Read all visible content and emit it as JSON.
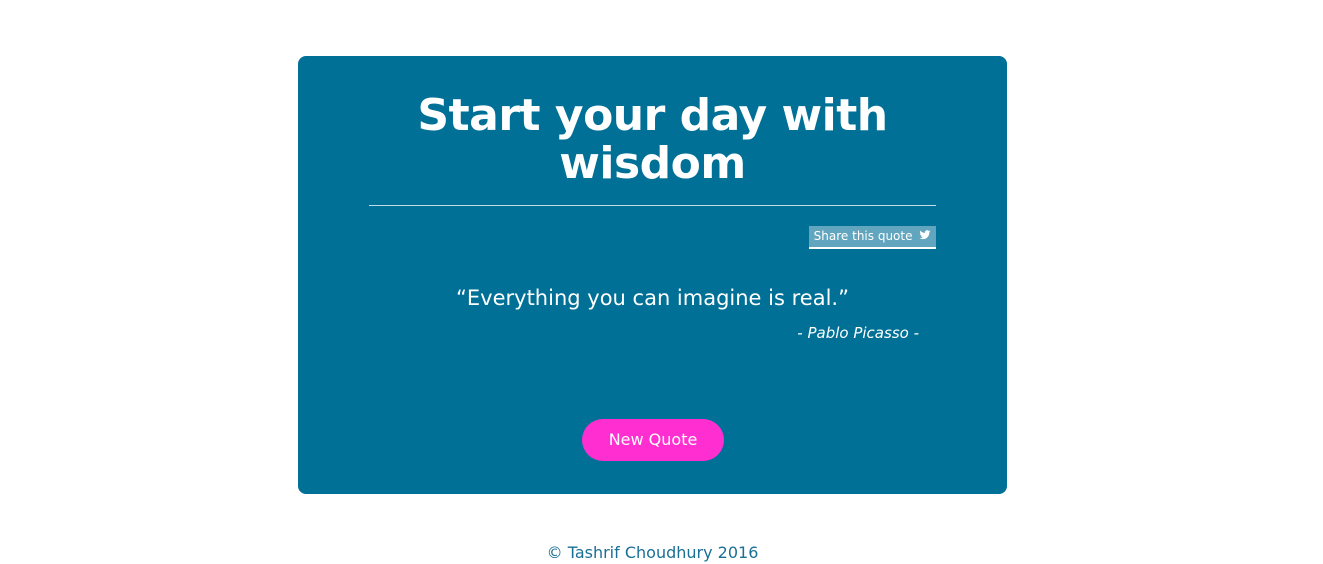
{
  "card": {
    "title_line1": "Start your day with",
    "title_line2": "wisdom",
    "share_label": "Share this quote",
    "share_icon": "twitter-icon",
    "quote_text": "“Everything you can imagine is real.”",
    "author": "- Pablo Picasso -",
    "new_quote_label": "New Quote"
  },
  "footer": {
    "text": "© Tashrif Choudhury 2016"
  },
  "colors": {
    "card_bg": "#007096",
    "button_bg": "#ff2ed0",
    "text": "#ffffff",
    "footer_text": "#1a6f95"
  }
}
